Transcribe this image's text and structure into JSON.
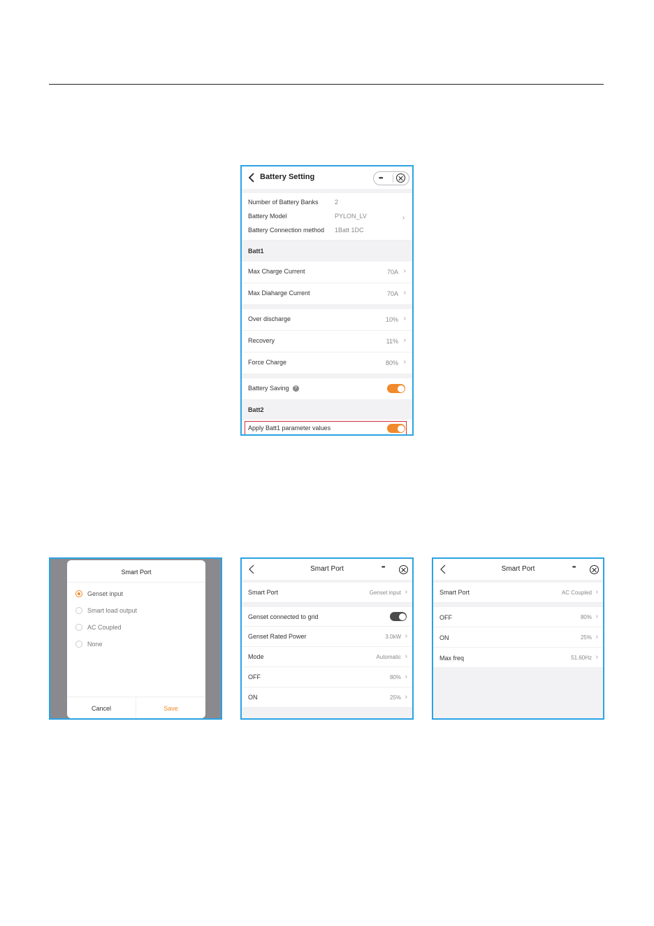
{
  "battery": {
    "title": "Battery Setting",
    "menu_dots": "•••",
    "info": {
      "banks_label": "Number of  Battery Banks",
      "banks_value": "2",
      "model_label": "Battery Model",
      "model_value": "PYLON_LV",
      "method_label": "Battery Connection method",
      "method_value": "1Batt 1DC"
    },
    "batt1_header": "Batt1",
    "max_charge_label": "Max Charge Current",
    "max_charge_value": "70A",
    "max_discharge_label": "Max Diaharge Current",
    "max_discharge_value": "70A",
    "over_discharge_label": "Over discharge",
    "over_discharge_value": "10%",
    "recovery_label": "Recovery",
    "recovery_value": "11%",
    "force_charge_label": "Force Charge",
    "force_charge_value": "80%",
    "saving_label": "Battery Saving",
    "help_glyph": "?",
    "batt2_header": "Batt2",
    "apply_label": "Apply Batt1 parameter values"
  },
  "dialog": {
    "title": "Smart Port",
    "options": [
      "Genset input",
      "Smart load output",
      "AC Coupled",
      "None"
    ],
    "cancel": "Cancel",
    "save": "Save"
  },
  "genset": {
    "title": "Smart Port",
    "menu_dots": "•••",
    "port_label": "Smart Port",
    "port_value": "Genset input",
    "grid_label": "Genset connected to grid",
    "power_label": "Genset Rated Power",
    "power_value": "3.0kW",
    "mode_label": "Mode",
    "mode_value": "Automatic",
    "off_label": "OFF",
    "off_value": "80%",
    "on_label": "ON",
    "on_value": "25%"
  },
  "ac": {
    "title": "Smart Port",
    "menu_dots": "•••",
    "port_label": "Smart Port",
    "port_value": "AC Coupled",
    "off_label": "OFF",
    "off_value": "80%",
    "on_label": "ON",
    "on_value": "25%",
    "freq_label": "Max freq",
    "freq_value": "51.60Hz"
  },
  "colors": {
    "frame": "#2aa3e4",
    "accent": "#f08a2c",
    "highlight": "#d0333a"
  }
}
